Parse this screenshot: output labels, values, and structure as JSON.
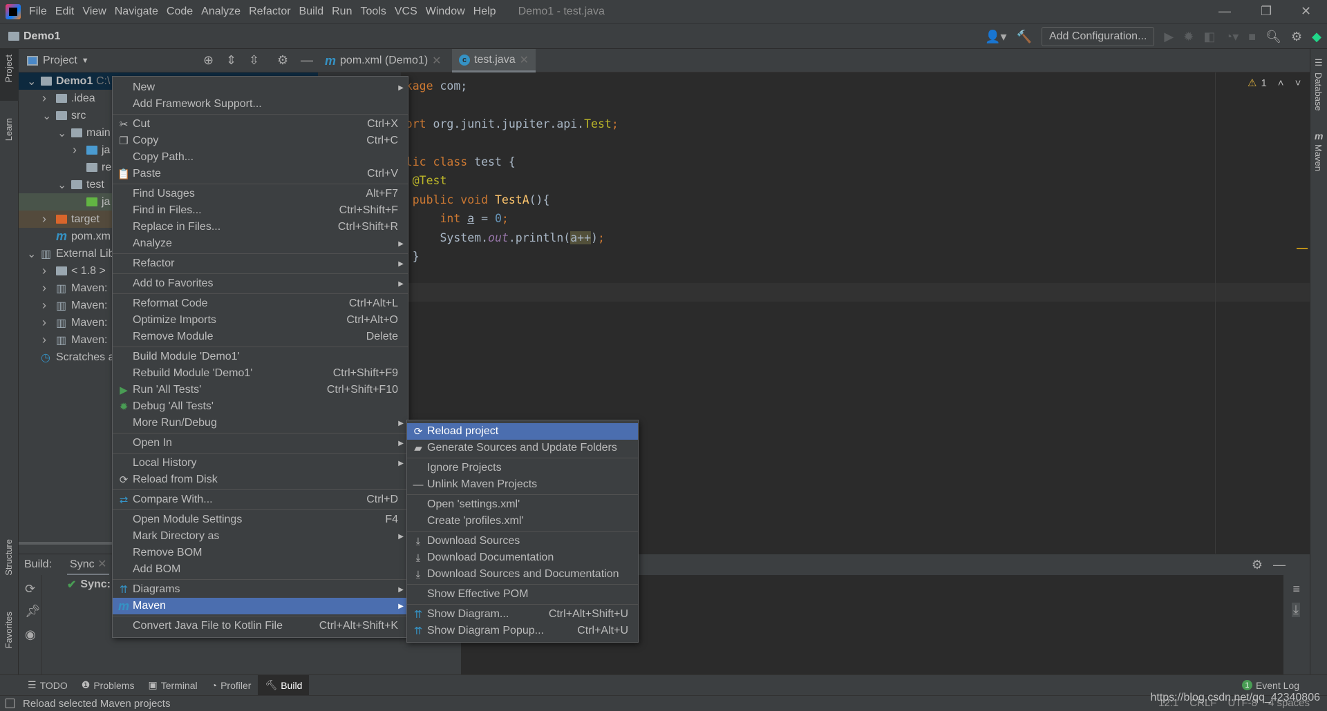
{
  "menubar": {
    "items": [
      "File",
      "Edit",
      "View",
      "Navigate",
      "Code",
      "Analyze",
      "Refactor",
      "Build",
      "Run",
      "Tools",
      "VCS",
      "Window",
      "Help"
    ],
    "window_title": "Demo1 - test.java"
  },
  "navbar": {
    "project": "Demo1",
    "add_configuration": "Add Configuration..."
  },
  "left_strip": {
    "project": "Project",
    "learn": "Learn",
    "structure": "Structure",
    "favorites": "Favorites"
  },
  "right_strip": {
    "database": "Database",
    "maven": "Maven"
  },
  "project_panel": {
    "title": "Project",
    "tree": [
      {
        "label": "Demo1",
        "extra": "C:\\",
        "level": 0,
        "arrow": "down",
        "icon": "module-folder",
        "state": "selected"
      },
      {
        "label": ".idea",
        "level": 1,
        "arrow": "right",
        "icon": "folder"
      },
      {
        "label": "src",
        "level": 1,
        "arrow": "down",
        "icon": "folder"
      },
      {
        "label": "main",
        "level": 2,
        "arrow": "down",
        "icon": "folder"
      },
      {
        "label": "ja",
        "level": 3,
        "arrow": "right",
        "icon": "source-folder"
      },
      {
        "label": "re",
        "level": 3,
        "arrow": "",
        "icon": "resources-folder"
      },
      {
        "label": "test",
        "level": 2,
        "arrow": "down",
        "icon": "folder"
      },
      {
        "label": "ja",
        "level": 3,
        "arrow": "",
        "icon": "test-folder",
        "state": "green"
      },
      {
        "label": "target",
        "level": 1,
        "arrow": "right",
        "icon": "excluded-folder",
        "state": "target"
      },
      {
        "label": "pom.xm",
        "level": 1,
        "arrow": "",
        "icon": "maven-file"
      },
      {
        "label": "External Lib",
        "level": 0,
        "arrow": "down",
        "icon": "library"
      },
      {
        "label": "< 1.8 >",
        "level": 1,
        "arrow": "right",
        "icon": "jdk"
      },
      {
        "label": "Maven:",
        "level": 1,
        "arrow": "right",
        "icon": "library"
      },
      {
        "label": "Maven:",
        "level": 1,
        "arrow": "right",
        "icon": "library"
      },
      {
        "label": "Maven:",
        "level": 1,
        "arrow": "right",
        "icon": "library"
      },
      {
        "label": "Maven:",
        "level": 1,
        "arrow": "right",
        "icon": "library"
      },
      {
        "label": "Scratches a",
        "level": 0,
        "arrow": "",
        "icon": "scratches"
      }
    ]
  },
  "editor": {
    "tabs": [
      {
        "label": "pom.xml (Demo1)",
        "icon": "maven-icon"
      },
      {
        "label": "test.java",
        "icon": "class-icon",
        "active": true
      }
    ],
    "warnings": "1",
    "lines": {
      "l1a": "package",
      "l1b": " com;",
      "l3a": "import",
      "l3b": " org.junit.jupiter.api.",
      "l3c": "Test",
      "l3d": ";",
      "l5a": "public class",
      "l5b": " test {",
      "l6": "    @Test",
      "l7a": "    public void ",
      "l7b": "TestA",
      "l7c": "(){",
      "l8a": "        int ",
      "l8b": "a",
      "l8c": " = ",
      "l8d": "0",
      "l8e": ";",
      "l9a": "        System.",
      "l9b": "out",
      "l9c": ".println(",
      "l9d": "a++",
      "l9e": ")",
      "l9f": ";",
      "l10": "    }"
    }
  },
  "build_panel": {
    "label": "Build:",
    "tab": "Sync",
    "sync_item": "Sync:"
  },
  "bottom_bar": {
    "items": [
      "TODO",
      "Problems",
      "Terminal",
      "Profiler",
      "Build"
    ],
    "event_log": "Event Log",
    "event_count": "1"
  },
  "status_bar": {
    "message": "Reload selected Maven projects",
    "position": "12:1",
    "line_sep": "CRLF",
    "encoding": "UTF-8",
    "indent": "4 spaces",
    "watermark": "https://blog.csdn.net/qq_42340806"
  },
  "context_menu": {
    "items": [
      {
        "label": "New",
        "submenu": true
      },
      {
        "label": "Add Framework Support...",
        "sep_after": true
      },
      {
        "label": "Cut",
        "shortcut": "Ctrl+X",
        "icon": "✂"
      },
      {
        "label": "Copy",
        "shortcut": "Ctrl+C",
        "icon": "❐"
      },
      {
        "label": "Copy Path..."
      },
      {
        "label": "Paste",
        "shortcut": "Ctrl+V",
        "icon": "📋",
        "sep_after": true
      },
      {
        "label": "Find Usages",
        "shortcut": "Alt+F7"
      },
      {
        "label": "Find in Files...",
        "shortcut": "Ctrl+Shift+F"
      },
      {
        "label": "Replace in Files...",
        "shortcut": "Ctrl+Shift+R"
      },
      {
        "label": "Analyze",
        "submenu": true,
        "sep_after": true
      },
      {
        "label": "Refactor",
        "submenu": true,
        "sep_after": true
      },
      {
        "label": "Add to Favorites",
        "submenu": true,
        "sep_after": true
      },
      {
        "label": "Reformat Code",
        "shortcut": "Ctrl+Alt+L"
      },
      {
        "label": "Optimize Imports",
        "shortcut": "Ctrl+Alt+O"
      },
      {
        "label": "Remove Module",
        "shortcut": "Delete",
        "sep_after": true
      },
      {
        "label": "Build Module 'Demo1'"
      },
      {
        "label": "Rebuild Module 'Demo1'",
        "shortcut": "Ctrl+Shift+F9"
      },
      {
        "label": "Run 'All Tests'",
        "shortcut": "Ctrl+Shift+F10",
        "icon": "▶",
        "icon_color": "#499c54"
      },
      {
        "label": "Debug 'All Tests'",
        "icon": "✹",
        "icon_color": "#499c54"
      },
      {
        "label": "More Run/Debug",
        "submenu": true,
        "sep_after": true
      },
      {
        "label": "Open In",
        "submenu": true,
        "sep_after": true
      },
      {
        "label": "Local History",
        "submenu": true
      },
      {
        "label": "Reload from Disk",
        "icon": "⟳",
        "sep_after": true
      },
      {
        "label": "Compare With...",
        "shortcut": "Ctrl+D",
        "icon": "⇄",
        "icon_color": "#3592c4",
        "sep_after": true
      },
      {
        "label": "Open Module Settings",
        "shortcut": "F4"
      },
      {
        "label": "Mark Directory as",
        "submenu": true
      },
      {
        "label": "Remove BOM"
      },
      {
        "label": "Add BOM",
        "sep_after": true
      },
      {
        "label": "Diagrams",
        "submenu": true,
        "icon": "⇈",
        "icon_color": "#3592c4"
      },
      {
        "label": "Maven",
        "submenu": true,
        "icon": "m",
        "icon_color": "#3592c4",
        "selected": true,
        "sep_after": true
      },
      {
        "label": "Convert Java File to Kotlin File",
        "shortcut": "Ctrl+Alt+Shift+K"
      }
    ]
  },
  "maven_submenu": {
    "items": [
      {
        "label": "Reload project",
        "icon": "⟳",
        "selected": true
      },
      {
        "label": "Generate Sources and Update Folders",
        "icon": "▰",
        "sep_after": true
      },
      {
        "label": "Ignore Projects"
      },
      {
        "label": "Unlink Maven Projects",
        "icon": "—",
        "sep_after": true
      },
      {
        "label": "Open 'settings.xml'"
      },
      {
        "label": "Create 'profiles.xml'",
        "sep_after": true
      },
      {
        "label": "Download Sources",
        "icon": "⤓"
      },
      {
        "label": "Download Documentation",
        "icon": "⤓"
      },
      {
        "label": "Download Sources and Documentation",
        "icon": "⤓",
        "sep_after": true
      },
      {
        "label": "Show Effective POM",
        "sep_after": true
      },
      {
        "label": "Show Diagram...",
        "shortcut": "Ctrl+Alt+Shift+U",
        "icon": "⇈",
        "icon_color": "#3592c4"
      },
      {
        "label": "Show Diagram Popup...",
        "shortcut": "Ctrl+Alt+U",
        "icon": "⇈",
        "icon_color": "#3592c4"
      }
    ]
  },
  "colors": {
    "panel": "#3c3f41",
    "editor": "#2b2b2b",
    "selection": "#4b6eaf",
    "text": "#bbbbbb"
  }
}
